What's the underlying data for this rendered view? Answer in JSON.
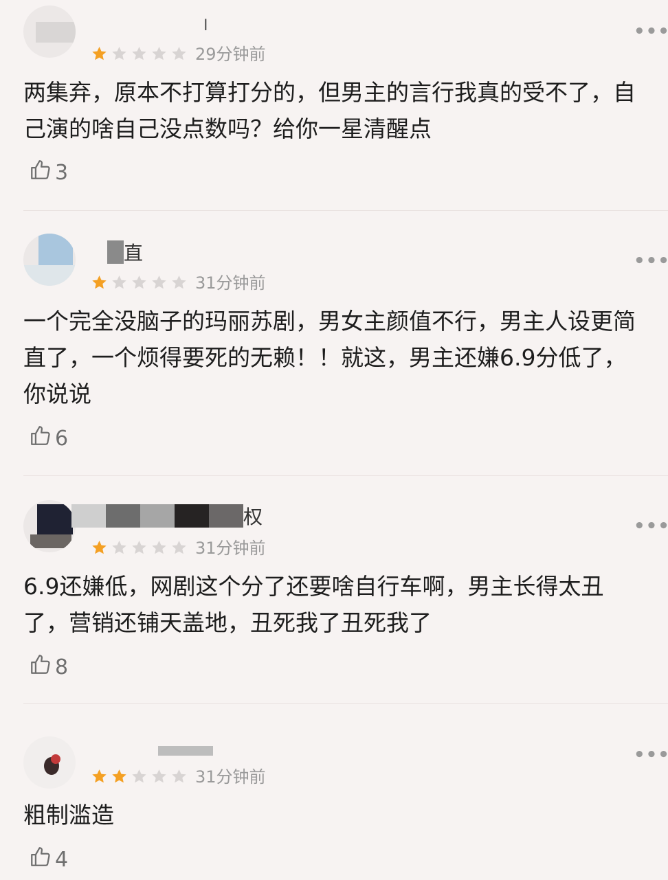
{
  "colors": {
    "star_filled": "#f4a023",
    "star_empty": "#d8d4d3",
    "meta_text": "#9a9a9a",
    "body_text": "#1d1d1d",
    "background": "#f7f3f2"
  },
  "icons": {
    "more": "more-dots-icon",
    "like": "thumbs-up-icon",
    "star": "star-icon"
  },
  "reviews": [
    {
      "username": "I",
      "rating": 1,
      "time": "29分钟前",
      "more_label": "•••",
      "content": "两集弃，原本不打算打分的，但男主的言行我真的受不了，自己演的啥自己没点数吗？给你一星清醒点",
      "likes": "3"
    },
    {
      "username": "直",
      "rating": 1,
      "time": "31分钟前",
      "more_label": "•••",
      "content": "一个完全没脑子的玛丽苏剧，男女主颜值不行，男主人设更简直了，一个烦得要死的无赖！！就这，男主还嫌6.9分低了，你说说",
      "likes": "6"
    },
    {
      "username": "权",
      "rating": 1,
      "time": "31分钟前",
      "more_label": "•••",
      "content": "6.9还嫌低，网剧这个分了还要啥自行车啊，男主长得太丑了，营销还铺天盖地，丑死我了丑死我了",
      "likes": "8"
    },
    {
      "username": "",
      "rating": 2,
      "time": "31分钟前",
      "more_label": "•••",
      "content": "粗制滥造",
      "likes": "4"
    }
  ]
}
